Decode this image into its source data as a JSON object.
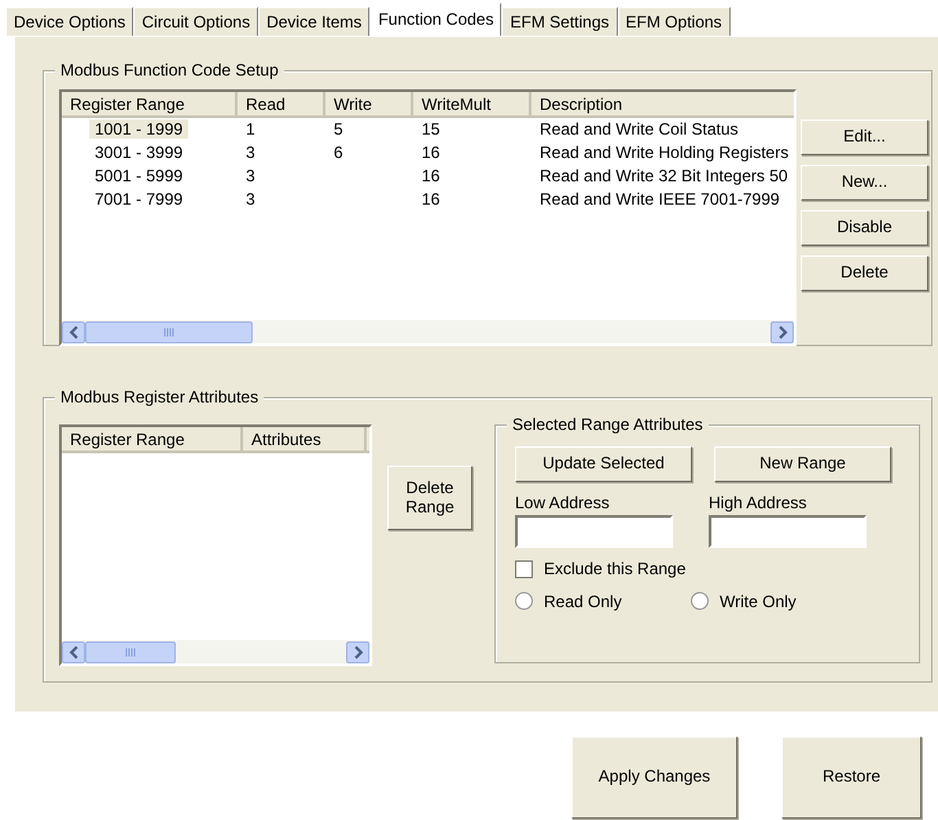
{
  "tabs": [
    {
      "label": "Device Options",
      "selected": false
    },
    {
      "label": "Circuit Options",
      "selected": false
    },
    {
      "label": "Device Items",
      "selected": false
    },
    {
      "label": "Function Codes",
      "selected": true
    },
    {
      "label": "EFM Settings",
      "selected": false
    },
    {
      "label": "EFM Options",
      "selected": false
    }
  ],
  "function_code_setup": {
    "title": "Modbus Function Code Setup",
    "columns": [
      "Register Range",
      "Read",
      "Write",
      "WriteMult",
      "Description"
    ],
    "rows": [
      {
        "cells": [
          "1001 - 1999",
          "1",
          "5",
          "15",
          "Read and Write Coil Status"
        ],
        "selected": true
      },
      {
        "cells": [
          "3001 - 3999",
          "3",
          "6",
          "16",
          "Read and Write Holding Registers"
        ],
        "selected": false
      },
      {
        "cells": [
          "5001 - 5999",
          "3",
          "",
          "16",
          "Read and Write 32 Bit Integers 50"
        ],
        "selected": false
      },
      {
        "cells": [
          "7001 - 7999",
          "3",
          "",
          "16",
          "Read and Write IEEE 7001-7999"
        ],
        "selected": false
      }
    ],
    "buttons": [
      "Edit...",
      "New...",
      "Disable",
      "Delete"
    ]
  },
  "register_attributes": {
    "title": "Modbus Register Attributes",
    "columns": [
      "Register Range",
      "Attributes"
    ],
    "delete_button": "Delete Range",
    "selected_range": {
      "title": "Selected Range Attributes",
      "update_button": "Update Selected",
      "new_button": "New Range",
      "low_label": "Low Address",
      "high_label": "High Address",
      "exclude": {
        "label": "Exclude this Range",
        "checked": false
      },
      "access": [
        {
          "label": "Read Only",
          "selected": false
        },
        {
          "label": "Write Only",
          "selected": false
        }
      ]
    }
  },
  "buttons": [
    "Apply Changes",
    "Restore"
  ]
}
